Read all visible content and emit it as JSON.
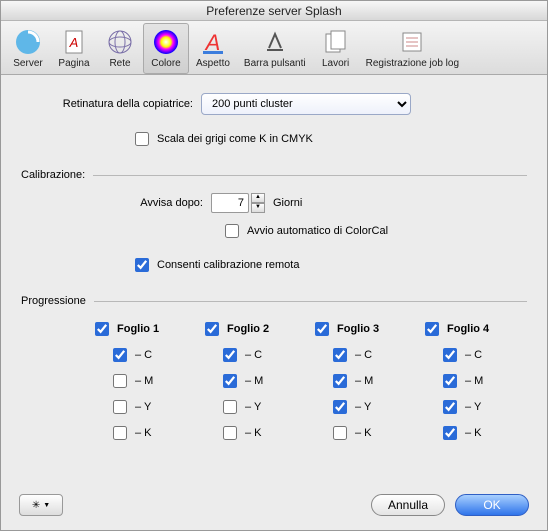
{
  "window": {
    "title": "Preferenze server Splash"
  },
  "toolbar": {
    "items": [
      {
        "id": "server",
        "label": "Server"
      },
      {
        "id": "pagina",
        "label": "Pagina"
      },
      {
        "id": "rete",
        "label": "Rete"
      },
      {
        "id": "colore",
        "label": "Colore",
        "selected": true
      },
      {
        "id": "aspetto",
        "label": "Aspetto"
      },
      {
        "id": "barra",
        "label": "Barra pulsanti"
      },
      {
        "id": "lavori",
        "label": "Lavori"
      },
      {
        "id": "reglog",
        "label": "Registrazione job log"
      }
    ]
  },
  "retinatura": {
    "label": "Retinatura della copiatrice:",
    "selected": "200 punti cluster"
  },
  "grayscale_as_k": {
    "label": "Scala dei grigi come K in CMYK",
    "checked": false
  },
  "calibration": {
    "header": "Calibrazione:",
    "warn_label": "Avvisa dopo:",
    "warn_value": "7",
    "warn_unit": "Giorni",
    "auto_colorcal": {
      "label": "Avvio automatico di ColorCal",
      "checked": false
    },
    "remote": {
      "label": "Consenti calibrazione remota",
      "checked": true
    }
  },
  "progression": {
    "header": "Progressione",
    "sheets": [
      {
        "name": "Foglio 1",
        "checked": true,
        "C": true,
        "M": false,
        "Y": false,
        "K": false
      },
      {
        "name": "Foglio 2",
        "checked": true,
        "C": true,
        "M": true,
        "Y": false,
        "K": false
      },
      {
        "name": "Foglio 3",
        "checked": true,
        "C": true,
        "M": true,
        "Y": true,
        "K": false
      },
      {
        "name": "Foglio 4",
        "checked": true,
        "C": true,
        "M": true,
        "Y": true,
        "K": true
      }
    ],
    "channel_labels": {
      "C": "– C",
      "M": "– M",
      "Y": "– Y",
      "K": "– K"
    }
  },
  "footer": {
    "cancel": "Annulla",
    "ok": "OK"
  }
}
